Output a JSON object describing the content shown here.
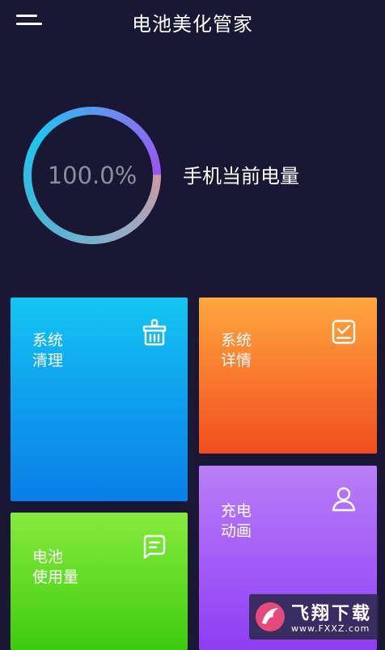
{
  "header": {
    "title": "电池美化管家",
    "menu_icon": "hamburger-menu-icon"
  },
  "battery": {
    "percent_text": "100.0%",
    "level": 1.0,
    "label": "手机当前电量",
    "ring_colors": [
      "#9a56f0",
      "#6a8cf2",
      "#1ec4f0",
      "#44b6d8",
      "#8aaecb",
      "#c99aa6"
    ]
  },
  "tiles": {
    "clean": {
      "line1": "系统",
      "line2": "清理",
      "icon": "broom-icon",
      "color_top": "#14c6f2",
      "color_bottom": "#0a7ee6"
    },
    "detail": {
      "line1": "系统",
      "line2": "详情",
      "icon": "clipboard-check-icon",
      "color_top": "#ffa73f",
      "color_bottom": "#f04e1e"
    },
    "usage": {
      "line1": "电池",
      "line2": "使用量",
      "icon": "chat-message-icon",
      "color_top": "#86ea3e",
      "color_bottom": "#3ccd10"
    },
    "anim": {
      "line1": "充电",
      "line2": "动画",
      "icon": "person-icon",
      "color_top": "#b97ef6",
      "color_bottom": "#8d3ef1"
    }
  },
  "watermark": {
    "brand": "飞翔下载",
    "url": "www.FXXZ.com"
  }
}
